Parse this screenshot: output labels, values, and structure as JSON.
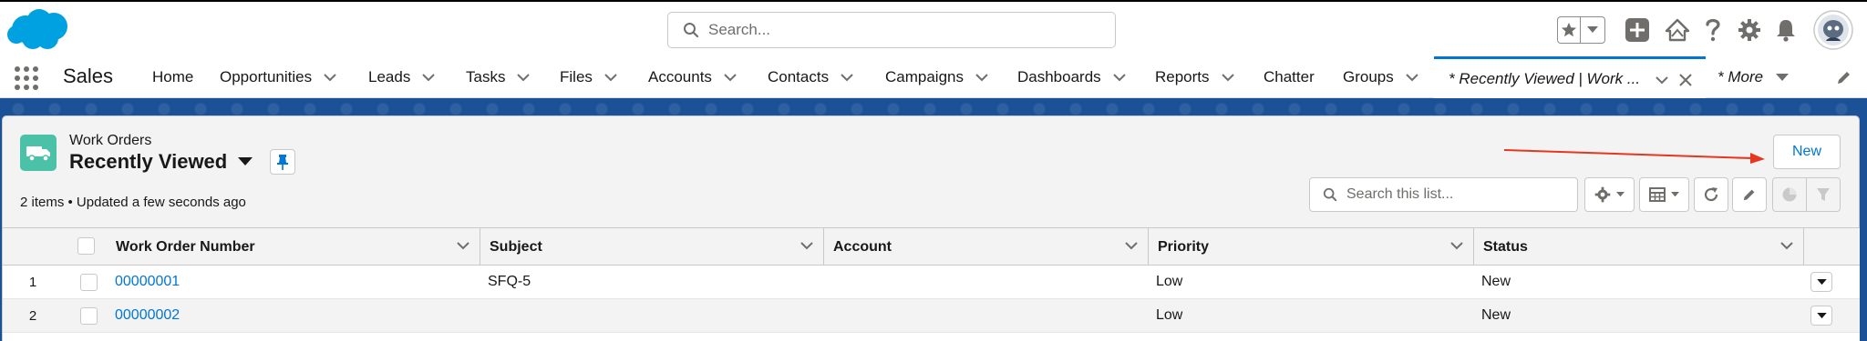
{
  "global_search": {
    "placeholder": "Search..."
  },
  "app": {
    "name": "Sales"
  },
  "nav": {
    "items": [
      {
        "label": "Home"
      },
      {
        "label": "Opportunities"
      },
      {
        "label": "Leads"
      },
      {
        "label": "Tasks"
      },
      {
        "label": "Files"
      },
      {
        "label": "Accounts"
      },
      {
        "label": "Contacts"
      },
      {
        "label": "Campaigns"
      },
      {
        "label": "Dashboards"
      },
      {
        "label": "Reports"
      },
      {
        "label": "Chatter"
      },
      {
        "label": "Groups"
      }
    ],
    "active_tab": "* Recently Viewed | Work ...",
    "more": "* More"
  },
  "list_view": {
    "object_label": "Work Orders",
    "view_name": "Recently Viewed",
    "meta": "2 items • Updated a few seconds ago",
    "new_button": "New",
    "search_placeholder": "Search this list..."
  },
  "table": {
    "columns": [
      "Work Order Number",
      "Subject",
      "Account",
      "Priority",
      "Status"
    ],
    "rows": [
      {
        "num": "1",
        "work_order_number": "00000001",
        "subject": "SFQ-5",
        "account": "",
        "priority": "Low",
        "status": "New"
      },
      {
        "num": "2",
        "work_order_number": "00000002",
        "subject": "",
        "account": "",
        "priority": "Low",
        "status": "New"
      }
    ]
  },
  "colors": {
    "brand": "#0176d3",
    "app_band": "#1b5297",
    "object_icon": "#4bc2a8",
    "annotation_arrow": "#e8351f"
  }
}
